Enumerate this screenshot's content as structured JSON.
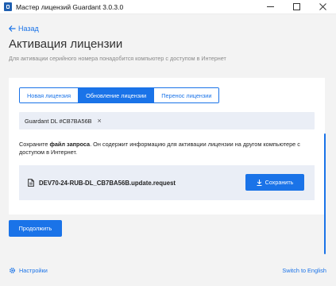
{
  "window": {
    "title": "Мастер лицензий Guardant 3.0.3.0",
    "app_icon": "guardant-app-icon",
    "controls": [
      "minimize-icon",
      "maximize-icon",
      "close-icon"
    ]
  },
  "header": {
    "back_label": "Назад",
    "title": "Активация лицензии",
    "subtitle": "Для активации серийного номера понадобится компьютер с доступом в Интернет"
  },
  "tabs": [
    {
      "label": "Новая лицензия",
      "active": false
    },
    {
      "label": "Обновление лицензии",
      "active": true
    },
    {
      "label": "Перенос лицензии",
      "active": false
    }
  ],
  "license_chip": {
    "text": "Guardant DL #CB7BA56B",
    "close_glyph": "×"
  },
  "description": {
    "before": "Сохраните ",
    "bold": "файл запроса",
    "after": ". Он содержит информацию для активации лицензии на другом компьютере с доступом в Интернет."
  },
  "file": {
    "name": "DEV70-24-RUB-DL_CB7BA56B.update.request",
    "save_label": "Сохранить"
  },
  "actions": {
    "continue_label": "Продолжить"
  },
  "footer": {
    "settings_label": "Настройки",
    "language_label": "Switch to English"
  },
  "colors": {
    "accent": "#1a73e8",
    "background": "#f3f3f3",
    "card": "#ffffff",
    "panel": "#eaeef6"
  }
}
